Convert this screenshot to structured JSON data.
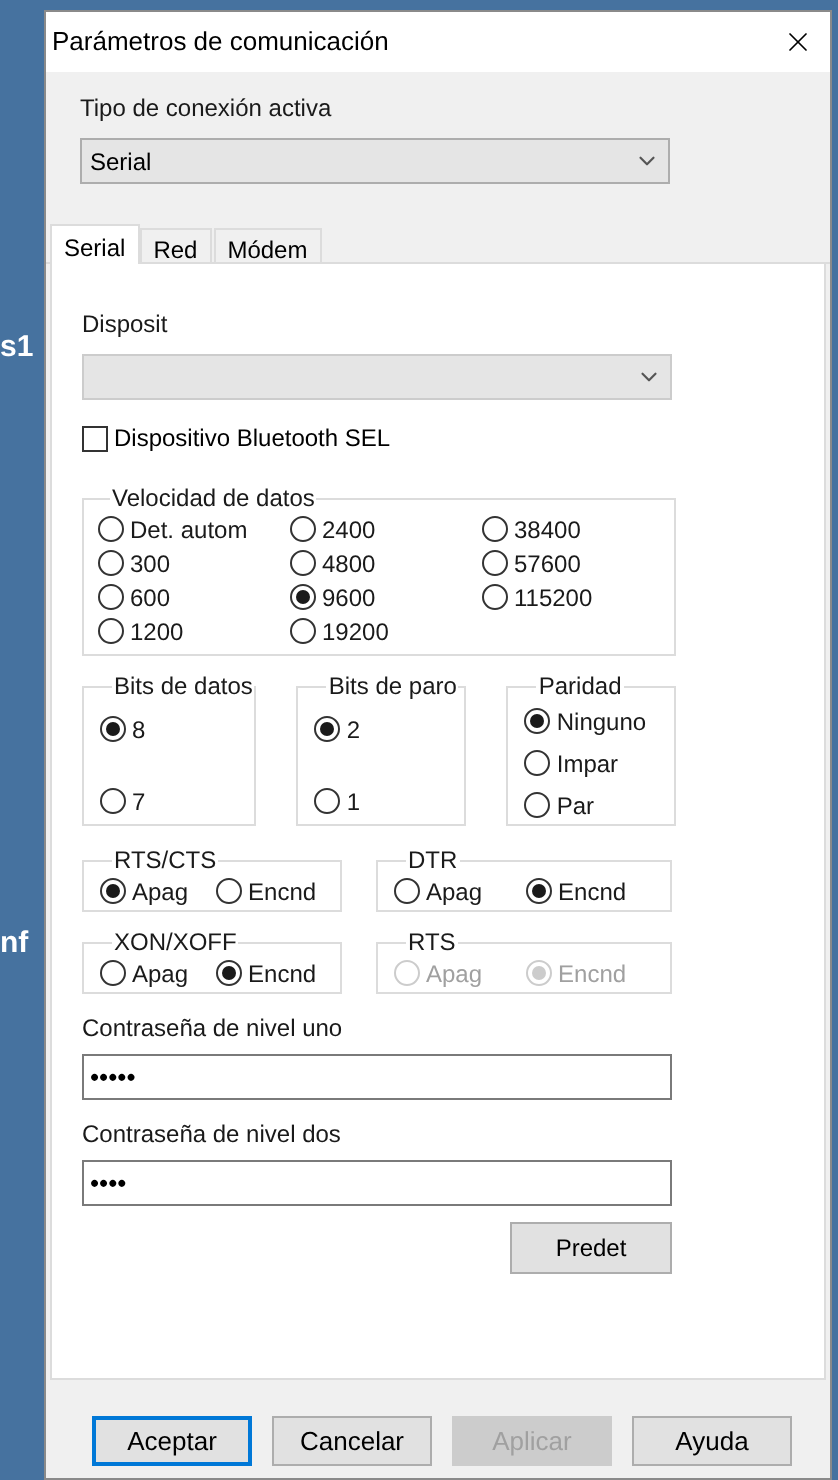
{
  "background_text": [
    "s1",
    "nf"
  ],
  "window": {
    "title": "Parámetros de comunicación"
  },
  "connection_type": {
    "label": "Tipo de conexión activa",
    "value": "Serial"
  },
  "tabs": [
    {
      "label": "Serial",
      "selected": true
    },
    {
      "label": "Red",
      "selected": false
    },
    {
      "label": "Módem",
      "selected": false
    }
  ],
  "device": {
    "label": "Disposit"
  },
  "bluetooth_checkbox": {
    "label": "Dispositivo Bluetooth SEL",
    "checked": false
  },
  "baud_rate": {
    "title": "Velocidad de datos",
    "columns": [
      {
        "options": [
          {
            "label": "Det. autom",
            "selected": false
          },
          {
            "label": "300",
            "selected": false
          },
          {
            "label": "600",
            "selected": false
          },
          {
            "label": "1200",
            "selected": false
          }
        ]
      },
      {
        "options": [
          {
            "label": "2400",
            "selected": false
          },
          {
            "label": "4800",
            "selected": false
          },
          {
            "label": "9600",
            "selected": true
          },
          {
            "label": "19200",
            "selected": false
          }
        ]
      },
      {
        "options": [
          {
            "label": "38400",
            "selected": false
          },
          {
            "label": "57600",
            "selected": false
          },
          {
            "label": "115200",
            "selected": false
          }
        ]
      }
    ]
  },
  "frame_groups": [
    {
      "title": "Bits de datos",
      "options": [
        {
          "label": "8",
          "selected": true
        },
        {
          "label": "7",
          "selected": false
        }
      ]
    },
    {
      "title": "Bits de paro",
      "options": [
        {
          "label": "2",
          "selected": true
        },
        {
          "label": "1",
          "selected": false
        }
      ]
    },
    {
      "title": "Paridad",
      "options": [
        {
          "label": "Ninguno",
          "selected": true
        },
        {
          "label": "Impar",
          "selected": false
        },
        {
          "label": "Par",
          "selected": false
        }
      ]
    }
  ],
  "flow_groups": [
    {
      "title": "RTS/CTS",
      "disabled": false,
      "options": [
        {
          "label": "Apag",
          "selected": true
        },
        {
          "label": "Encnd",
          "selected": false
        }
      ]
    },
    {
      "title": "DTR",
      "disabled": false,
      "options": [
        {
          "label": "Apag",
          "selected": false
        },
        {
          "label": "Encnd",
          "selected": true
        }
      ]
    },
    {
      "title": "XON/XOFF",
      "disabled": false,
      "options": [
        {
          "label": "Apag",
          "selected": false
        },
        {
          "label": "Encnd",
          "selected": true
        }
      ]
    },
    {
      "title": "RTS",
      "disabled": true,
      "options": [
        {
          "label": "Apag",
          "selected": false
        },
        {
          "label": "Encnd",
          "selected": true
        }
      ]
    }
  ],
  "passwords": [
    {
      "label": "Contraseña de nivel uno",
      "value": "•••••"
    },
    {
      "label": "Contraseña de nivel dos",
      "value": "••••"
    }
  ],
  "defaults_button": {
    "label": "Predet"
  },
  "buttons": [
    {
      "label": "Aceptar",
      "kind": "default",
      "disabled": false
    },
    {
      "label": "Cancelar",
      "kind": "normal",
      "disabled": false
    },
    {
      "label": "Aplicar",
      "kind": "normal",
      "disabled": true
    },
    {
      "label": "Ayuda",
      "kind": "normal",
      "disabled": false
    }
  ]
}
